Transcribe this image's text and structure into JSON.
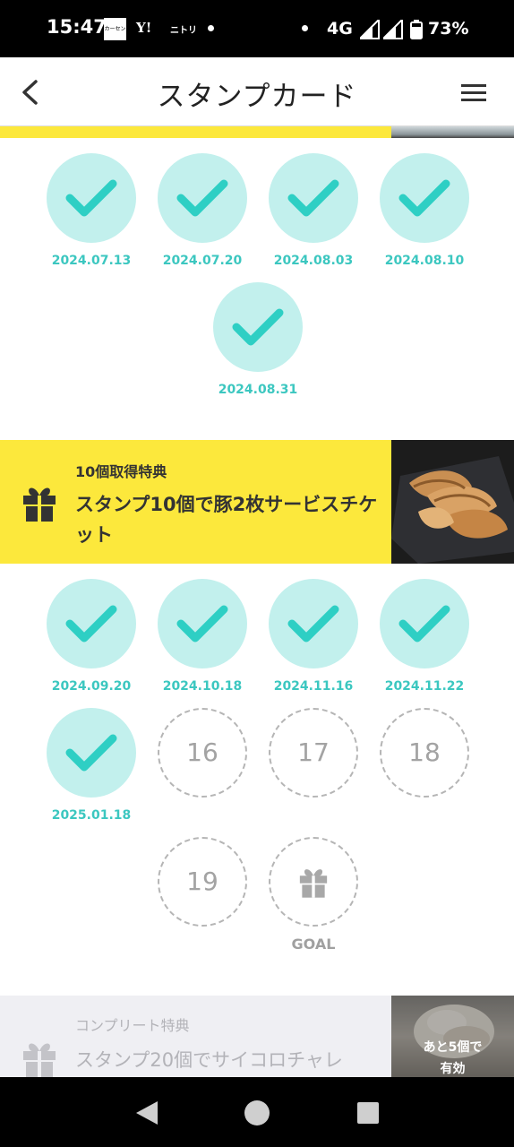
{
  "status_bar": {
    "time": "15:47",
    "app_icon_1": "カーセンサー",
    "app_icon_2": "Y!",
    "app_icon_3": "ニトリ",
    "network": "4G",
    "battery": "73%"
  },
  "header": {
    "title": "スタンプカード",
    "back_icon": "chevron-left-icon",
    "menu_icon": "hamburger-menu-icon"
  },
  "section1": {
    "stamps": [
      {
        "date": "2024.07.13"
      },
      {
        "date": "2024.07.20"
      },
      {
        "date": "2024.08.03"
      },
      {
        "date": "2024.08.10"
      },
      {
        "date": "2024.08.31"
      }
    ]
  },
  "reward_banner": {
    "subtitle": "10個取得特典",
    "title": "スタンプ10個で豚2枚サービスチケット",
    "icon": "gift-icon",
    "accent": "#fce83c"
  },
  "section2": {
    "stamps": [
      {
        "date": "2024.09.20"
      },
      {
        "date": "2024.10.18"
      },
      {
        "date": "2024.11.16"
      },
      {
        "date": "2024.11.22"
      },
      {
        "date": "2025.01.18"
      }
    ],
    "empty_slots": [
      "16",
      "17",
      "18",
      "19"
    ],
    "goal_label": "GOAL"
  },
  "complete_banner": {
    "subtitle": "コンプリート特典",
    "title": "スタンプ20個でサイコロチャレ",
    "remaining_line1": "あと5個で",
    "remaining_line2": "有効"
  },
  "colors": {
    "stamp_fill": "#c2f0ed",
    "check": "#2ecfc4",
    "date_text": "#3cc7c0",
    "banner_yellow": "#fce83c"
  }
}
